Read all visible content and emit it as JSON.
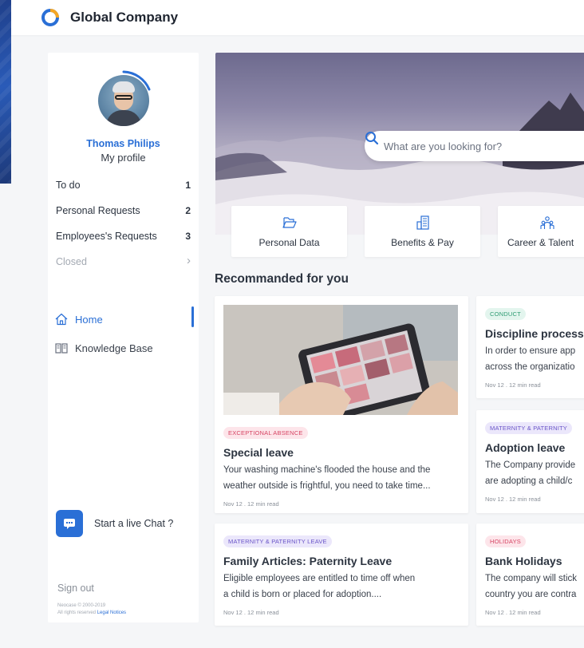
{
  "app": {
    "brand_name": "Global Company",
    "accent_color": "#2a6fd6"
  },
  "profile": {
    "name": "Thomas Philips",
    "link_label": "My profile"
  },
  "requests": [
    {
      "label": "To do",
      "count": "1"
    },
    {
      "label": "Personal Requests",
      "count": "2"
    },
    {
      "label": "Employees's Requests",
      "count": "3"
    },
    {
      "label": "Closed",
      "count": ""
    }
  ],
  "nav": [
    {
      "label": "Home",
      "icon": "home-icon",
      "active": true
    },
    {
      "label": "Knowledge Base",
      "icon": "book-icon",
      "active": false
    }
  ],
  "chat": {
    "label": "Start a live Chat ?",
    "icon": "chat-icon"
  },
  "footer": {
    "sign_out": "Sign out",
    "copyright": "Neocase © 2000-2019",
    "rights": "All rights reserved",
    "legal_link": "Legal Notices"
  },
  "search": {
    "placeholder": "What are you looking for?"
  },
  "quick_links": [
    {
      "label": "Personal Data",
      "icon": "folder-icon"
    },
    {
      "label": "Benefits & Pay",
      "icon": "building-icon"
    },
    {
      "label": "Career & Talent",
      "icon": "people-icon"
    }
  ],
  "recommended": {
    "title": "Recommanded for you",
    "cards": [
      {
        "tag": "EXCEPTIONAL ABSENCE",
        "title": "Special leave",
        "desc_lines": [
          "Your washing machine's flooded the house and the",
          "weather outside is frightful, you need to take time..."
        ],
        "meta": "Nov 12 . 12 min read"
      },
      {
        "tag": "CONDUCT",
        "title": "Discipline process",
        "desc_lines": [
          "In order to ensure app",
          "across the organizatio"
        ],
        "meta": "Nov 12 . 12 min read"
      },
      {
        "tag": "MATERNITY & PATERNITY",
        "title": "Adoption leave",
        "desc_lines": [
          "The Company provide",
          "are adopting a child/c"
        ],
        "meta": "Nov 12 . 12 min read"
      },
      {
        "tag": "MATERNITY & PATERNITY LEAVE",
        "title": "Family Articles: Paternity Leave",
        "desc_lines": [
          "Eligible employees are entitled to time off when",
          "a child is born or placed for adoption...."
        ],
        "meta": "Nov 12 . 12 min read"
      },
      {
        "tag": "HOLIDAYS",
        "title": "Bank Holidays",
        "desc_lines": [
          "The company will stick",
          "country you are contra"
        ],
        "meta": "Nov 12 . 12 min read"
      }
    ]
  }
}
